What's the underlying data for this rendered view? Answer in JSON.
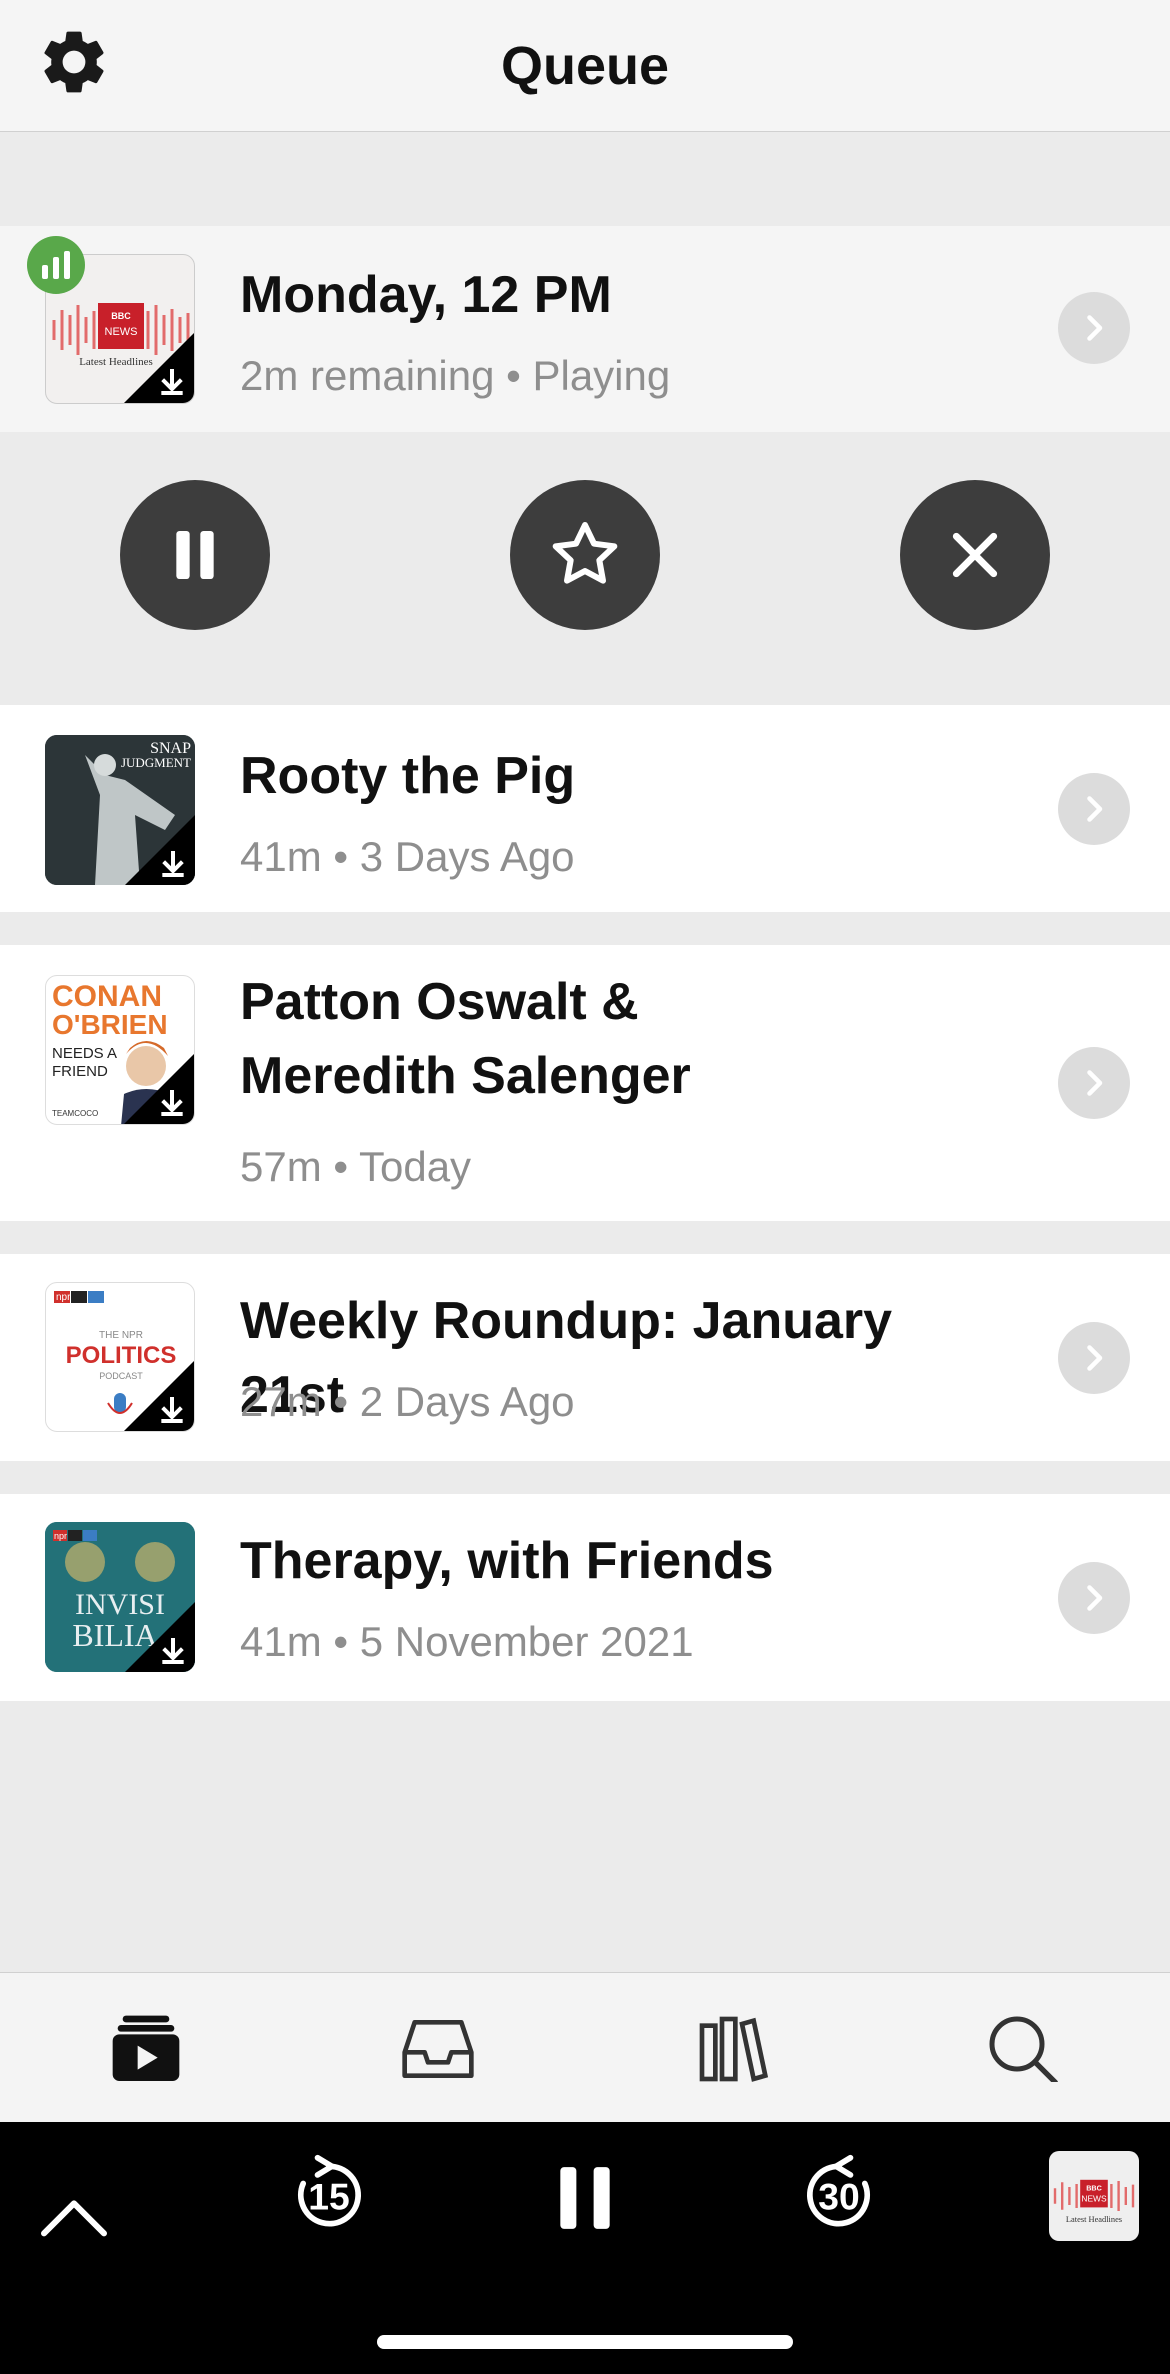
{
  "header": {
    "title": "Queue"
  },
  "now_playing": {
    "title": "Monday, 12 PM",
    "meta": "2m remaining • Playing",
    "artwork": {
      "brand": "BBC",
      "line1": "NEWS",
      "caption": "Latest Headlines"
    }
  },
  "queue": [
    {
      "title": "Rooty the Pig",
      "meta": "41m • 3 Days Ago",
      "artwork": {
        "line1": "SNAP",
        "line2": "JUDGMENT"
      }
    },
    {
      "title": "Patton Oswalt & Meredith Salenger",
      "meta": "57m • Today",
      "artwork": {
        "line1": "CONAN",
        "line2": "O'BRIEN",
        "line3": "NEEDS A",
        "line4": "FRIEND",
        "footer": "TEAMCOCO"
      }
    },
    {
      "title": "Weekly Roundup: January 21st",
      "meta": "27m • 2 Days Ago",
      "artwork": {
        "brand": "npr",
        "line1": "THE NPR",
        "line2": "POLITICS",
        "line3": "PODCAST"
      }
    },
    {
      "title": "Therapy, with Friends",
      "meta": "41m • 5 November 2021",
      "artwork": {
        "brand": "npr",
        "line1": "INVISI",
        "line2": "BILIA"
      }
    }
  ],
  "tabs": [
    {
      "name": "now-playing",
      "icon": "play-stack-icon"
    },
    {
      "name": "inbox",
      "icon": "inbox-icon"
    },
    {
      "name": "library",
      "icon": "library-icon"
    },
    {
      "name": "search",
      "icon": "search-icon"
    }
  ],
  "player": {
    "skip_back": "15",
    "skip_forward": "30",
    "artwork": {
      "brand": "BBC",
      "line1": "NEWS",
      "caption": "Latest Headlines"
    }
  },
  "colors": {
    "accent_green": "#59a84a",
    "control_dark": "#3d3d3d",
    "conan_orange": "#e8772e",
    "politics_red": "#d0302c"
  }
}
